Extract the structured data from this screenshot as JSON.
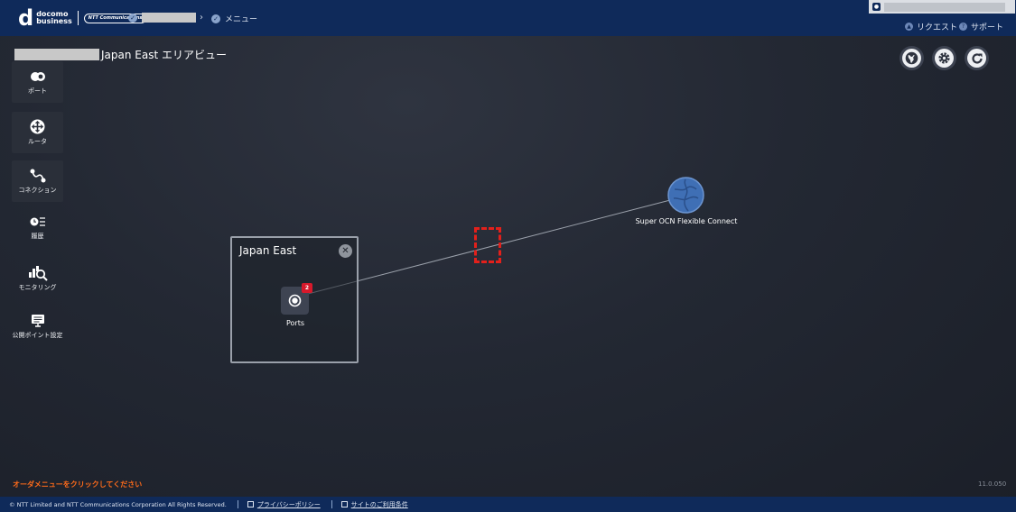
{
  "header": {
    "logo_top": "docomo",
    "logo_bottom": "business",
    "ntt_badge": "NTT Communications",
    "breadcrumb_last": "メニュー",
    "links": [
      {
        "label": "リクエスト",
        "icon": "bell-icon"
      },
      {
        "label": "サポート",
        "icon": "help-icon"
      }
    ]
  },
  "page": {
    "title": "Japan East エリアビュー"
  },
  "sidebar": {
    "items": [
      {
        "label": "ポート",
        "icon": "port-icon"
      },
      {
        "label": "ルータ",
        "icon": "router-icon"
      },
      {
        "label": "コネクション",
        "icon": "connection-icon"
      },
      {
        "label": "履歴",
        "icon": "history-icon"
      },
      {
        "label": "モニタリング",
        "icon": "monitoring-icon"
      },
      {
        "label": "公開ポイント設定",
        "icon": "public-point-icon"
      }
    ]
  },
  "toolbar": {
    "buttons": [
      "globe-icon",
      "gear-icon",
      "refresh-icon"
    ]
  },
  "area": {
    "title": "Japan East",
    "ports_label": "Ports",
    "ports_badge": "2"
  },
  "connect_node": {
    "label": "Super OCN Flexible Connect"
  },
  "footer": {
    "hint": "オーダメニューをクリックしてください",
    "version": "11.0.050",
    "copyright": "© NTT Limited and NTT Communications Corporation All Rights Reserved.",
    "privacy": "プライバシーポリシー",
    "terms": "サイトのご利用条件"
  },
  "colors": {
    "header_bg": "#0f2a5a",
    "badge_red": "#d7192b",
    "hint_orange": "#ff6b1a",
    "highlight_red": "#e3201b",
    "node_blue": "#3f6fb5"
  }
}
